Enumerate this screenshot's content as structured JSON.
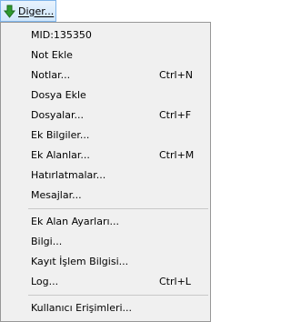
{
  "toolbar": {
    "button_label": "Diger...",
    "button_icon": "green-down-arrow-icon",
    "accent_color": "#2e8b2e"
  },
  "menu": {
    "groups": [
      [
        {
          "label": "MID:135350",
          "shortcut": ""
        },
        {
          "label": "Not Ekle",
          "shortcut": ""
        },
        {
          "label": "Notlar...",
          "shortcut": "Ctrl+N"
        },
        {
          "label": "Dosya Ekle",
          "shortcut": ""
        },
        {
          "label": "Dosyalar...",
          "shortcut": "Ctrl+F"
        },
        {
          "label": "Ek Bilgiler...",
          "shortcut": ""
        },
        {
          "label": "Ek Alanlar...",
          "shortcut": "Ctrl+M"
        },
        {
          "label": "Hatırlatmalar...",
          "shortcut": ""
        },
        {
          "label": "Mesajlar...",
          "shortcut": ""
        }
      ],
      [
        {
          "label": "Ek Alan Ayarları...",
          "shortcut": ""
        },
        {
          "label": "Bilgi...",
          "shortcut": ""
        },
        {
          "label": "Kayıt İşlem Bilgisi...",
          "shortcut": ""
        },
        {
          "label": "Log...",
          "shortcut": "Ctrl+L"
        }
      ],
      [
        {
          "label": "Kullanıcı Erişimleri...",
          "shortcut": ""
        }
      ]
    ]
  }
}
